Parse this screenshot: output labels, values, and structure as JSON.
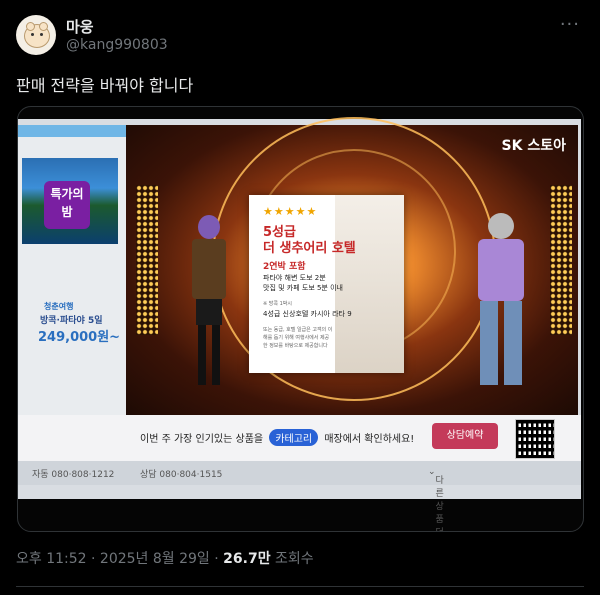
{
  "header": {
    "display_name": "마웅",
    "handle": "@kang990803",
    "more_icon": "more-icon"
  },
  "tweet": {
    "text": "판매 전략을 바꿔야 합니다"
  },
  "media": {
    "brand": "SK 스토아",
    "card": {
      "stars": "★★★★★",
      "line1": "5성급",
      "line2": "더 생추어리 호텔",
      "line3": "2연박 포함",
      "line4": "파타야 해변 도보 2분",
      "line5": "맛집 및 카페 도보 5분 이내",
      "line6": "※ 방콕 1박시",
      "line7": "4성급 신상호텔 카시아 라타 9",
      "line8": "또는 동급, 호텔 일급은 고객의 이해를 돕기 위해 여행사에서 제공한 정보를 바탕으로 제공합니다"
    },
    "side": {
      "special": "특가의 밤",
      "package": "청춘여행",
      "package_desc": "방콕·파타야 5일",
      "price": "249,000원~"
    },
    "bottom": {
      "promo_before": "이번 주 가장 인기있는 상품을",
      "promo_pill": "카테고리",
      "promo_after": "매장에서 확인하세요!",
      "buy_button": "상담예약"
    },
    "info": {
      "auto": "자동 080·808·1212",
      "consult": "상담 080·804·1515",
      "more": "다른 상품 더보기"
    }
  },
  "footer": {
    "time": "오후 11:52 · 2025년 8월 29일 · ",
    "views_count": "26.7만",
    "views_label": " 조회수"
  }
}
